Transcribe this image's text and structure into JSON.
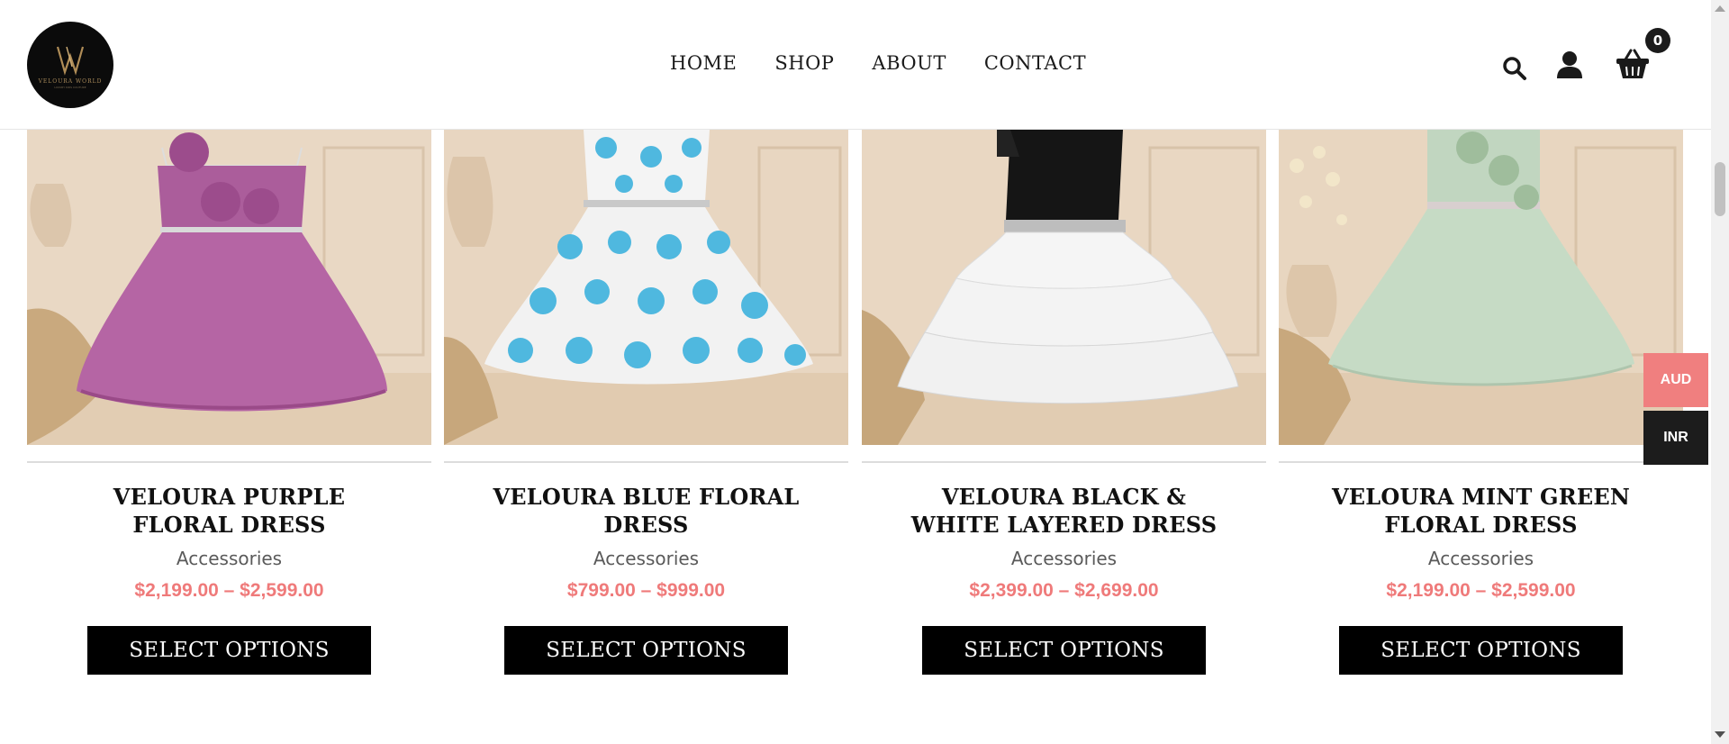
{
  "brand": {
    "logo_text": "VELOURA WORLD",
    "logo_sub": "LUXURY KIDS COUTURE",
    "monogram": "VW"
  },
  "nav": [
    {
      "label": "HOME"
    },
    {
      "label": "SHOP"
    },
    {
      "label": "ABOUT"
    },
    {
      "label": "CONTACT"
    }
  ],
  "header_icons": [
    "search-icon",
    "account-icon",
    "cart-icon"
  ],
  "cart": {
    "count": "0"
  },
  "products": [
    {
      "title": "VELOURA PURPLE FLORAL DRESS",
      "category": "Accessories",
      "price": "$2,199.00 – $2,599.00",
      "button": "SELECT OPTIONS",
      "dress_color": "#b2609f"
    },
    {
      "title": "VELOURA BLUE FLORAL DRESS",
      "category": "Accessories",
      "price": "$799.00 – $999.00",
      "button": "SELECT OPTIONS",
      "dress_color": "#4fb8df"
    },
    {
      "title": "VELOURA BLACK & WHITE LAYERED DRESS",
      "category": "Accessories",
      "price": "$2,399.00 – $2,699.00",
      "button": "SELECT OPTIONS",
      "dress_color": "#111111"
    },
    {
      "title": "VELOURA MINT GREEN FLORAL DRESS",
      "category": "Accessories",
      "price": "$2,199.00 – $2,599.00",
      "button": "SELECT OPTIONS",
      "dress_color": "#c3d8c2"
    }
  ],
  "currency": {
    "options": [
      "AUD",
      "INR"
    ],
    "selected": "AUD"
  },
  "colors": {
    "price": "#ef7a7a",
    "aud_bg": "#f07f7f",
    "inr_bg": "#1c1c1c",
    "button_bg": "#000000"
  }
}
